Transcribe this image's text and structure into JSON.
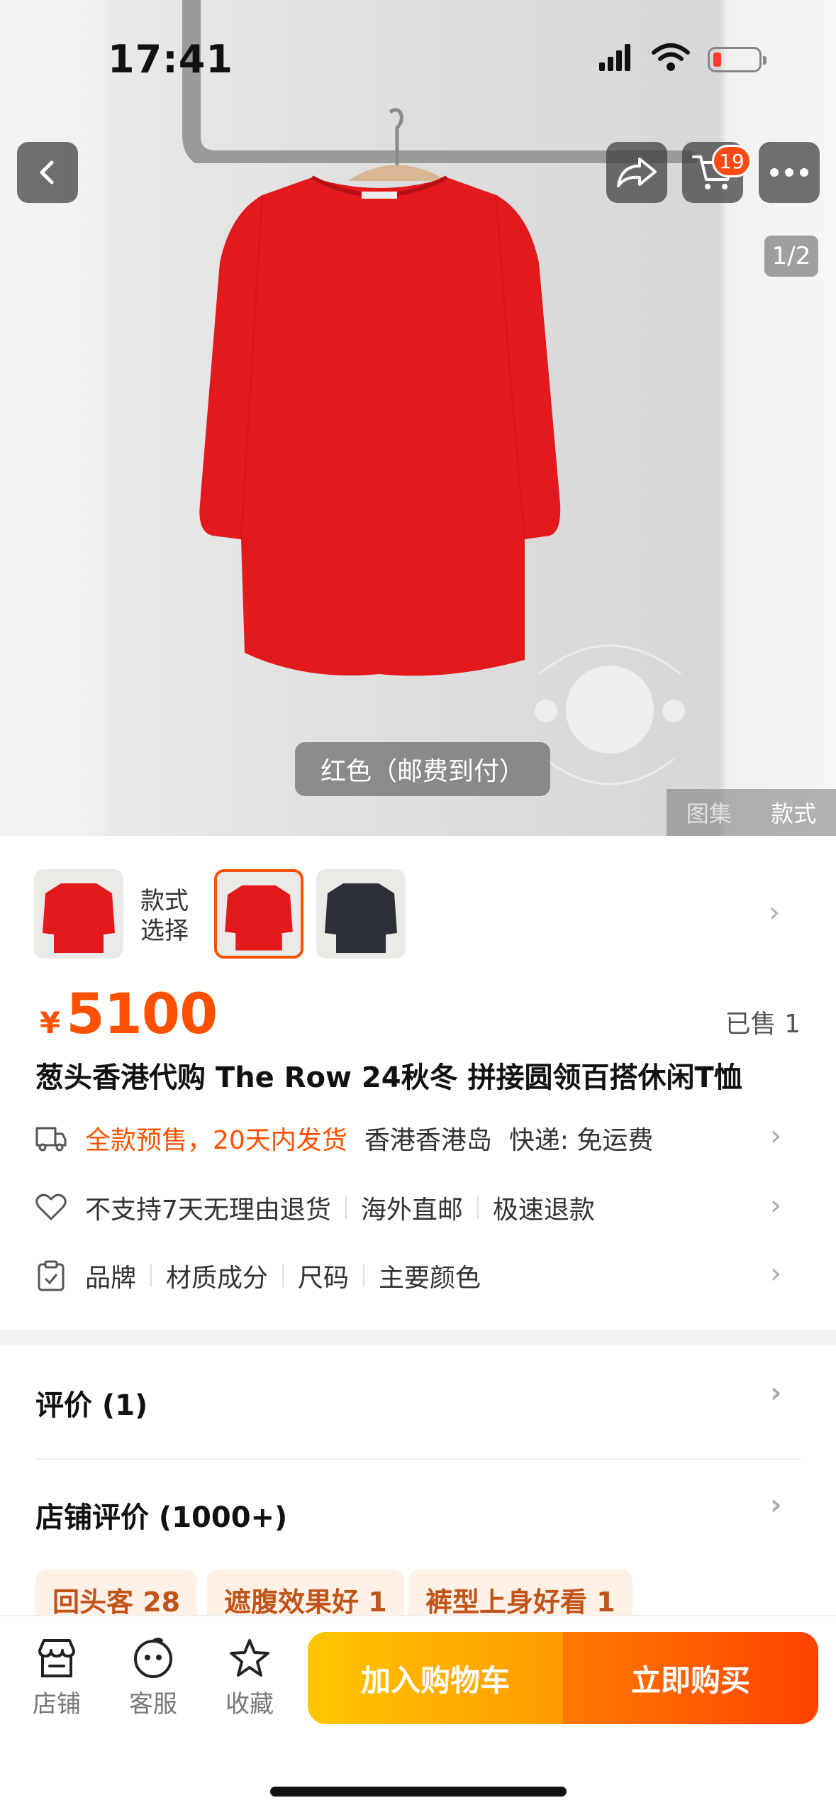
{
  "status": {
    "time": "17:41"
  },
  "nav": {
    "cart_count": "19"
  },
  "gallery": {
    "pager": "1/2",
    "caption": "红色（邮费到付）",
    "tabs": [
      "图集",
      "款式"
    ]
  },
  "variants": {
    "label_line1": "款式",
    "label_line2": "选择"
  },
  "product": {
    "currency": "¥",
    "price": "5100",
    "sold": "已售 1",
    "title": "葱头香港代购 The Row 24秋冬 拼接圆领百搭休闲T恤"
  },
  "shipping": {
    "presale": "全款预售，20天内发货",
    "origin": "香港香港岛",
    "express": "快递: 免运费"
  },
  "service": {
    "items": [
      "不支持7天无理由退货",
      "海外直邮",
      "极速退款"
    ]
  },
  "params": {
    "items": [
      "品牌",
      "材质成分",
      "尺码",
      "主要颜色"
    ]
  },
  "reviews": {
    "title": "评价 (1)",
    "shop_title": "店铺评价 (1000+)",
    "tags": [
      "回头客 28",
      "遮腹效果好 1",
      "裤型上身好看 1"
    ]
  },
  "bottom": {
    "shop": "店铺",
    "service": "客服",
    "favorite": "收藏",
    "add_cart": "加入购物车",
    "buy_now": "立即购买"
  },
  "colors": {
    "accent": "#ff5000",
    "shirt_red": "#e3191e"
  }
}
